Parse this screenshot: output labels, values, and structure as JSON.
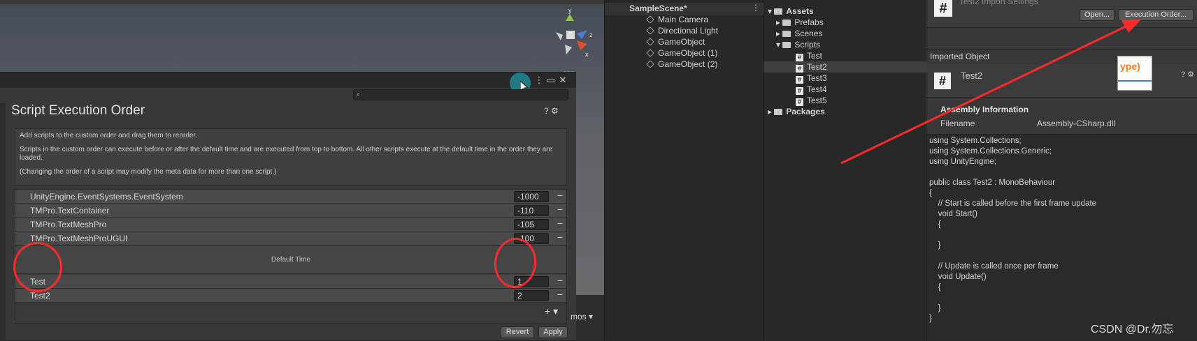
{
  "scene": {
    "persp_label": "rsp",
    "gizmo_axes": {
      "x": "x",
      "y": "y",
      "z": "z"
    }
  },
  "settings_window": {
    "title": "Script Execution Order",
    "help_lines": [
      "Add scripts to the custom order and drag them to reorder.",
      "Scripts in the custom order can execute before or after the default time and are executed from top to bottom. All other scripts execute at the default time in the order they are loaded.",
      "(Changing the order of a script may modify the meta data for more than one script.)"
    ],
    "before_default": [
      {
        "name": "UnityEngine.EventSystems.EventSystem",
        "value": "-1000"
      },
      {
        "name": "TMPro.TextContainer",
        "value": "-110"
      },
      {
        "name": "TMPro.TextMeshPro",
        "value": "-105"
      },
      {
        "name": "TMPro.TextMeshProUGUI",
        "value": "-100"
      }
    ],
    "default_time_label": "Default Time",
    "after_default": [
      {
        "name": "Test",
        "value": "1"
      },
      {
        "name": "Test2",
        "value": "2"
      }
    ],
    "remove_symbol": "−",
    "add_symbol": "+ ▾",
    "revert_label": "Revert",
    "apply_label": "Apply",
    "title_icons": "? ⚙",
    "window_buttons": {
      "menu": "⋮",
      "max": "▭",
      "close": "✕"
    }
  },
  "gizmos_label": "mos ▾",
  "hierarchy": {
    "scene_name": "SampleScene*",
    "items": [
      "Main Camera",
      "Directional Light",
      "GameObject",
      "GameObject (1)",
      "GameObject (2)"
    ]
  },
  "project": {
    "root": "Assets",
    "folders": [
      "Prefabs",
      "Scenes",
      "Scripts"
    ],
    "scripts": [
      "Test",
      "Test2",
      "Test3",
      "Test4",
      "Test5"
    ],
    "packages": "Packages",
    "selected": "Test2"
  },
  "inspector": {
    "header_title": "Test2 Import Settings",
    "open_label": "Open...",
    "execution_order_label": "Execution Order...",
    "imported_object_label": "Imported Object",
    "imported_name": "Test2",
    "preview_text": "ype)",
    "assembly_title": "Assembly Information",
    "filename_label": "Filename",
    "filename_value": "Assembly-CSharp.dll",
    "code": "using System.Collections;\nusing System.Collections.Generic;\nusing UnityEngine;\n\npublic class Test2 : MonoBehaviour\n{\n    // Start is called before the first frame update\n    void Start()\n    {\n\n    }\n\n    // Update is called once per frame\n    void Update()\n    {\n\n    }\n}",
    "help_icons": "? ⚙"
  },
  "watermark": "CSDN @Dr.勿忘",
  "colors": {
    "annotation_red": "#ff2a2a",
    "cursor_teal": "#1e96a0"
  }
}
